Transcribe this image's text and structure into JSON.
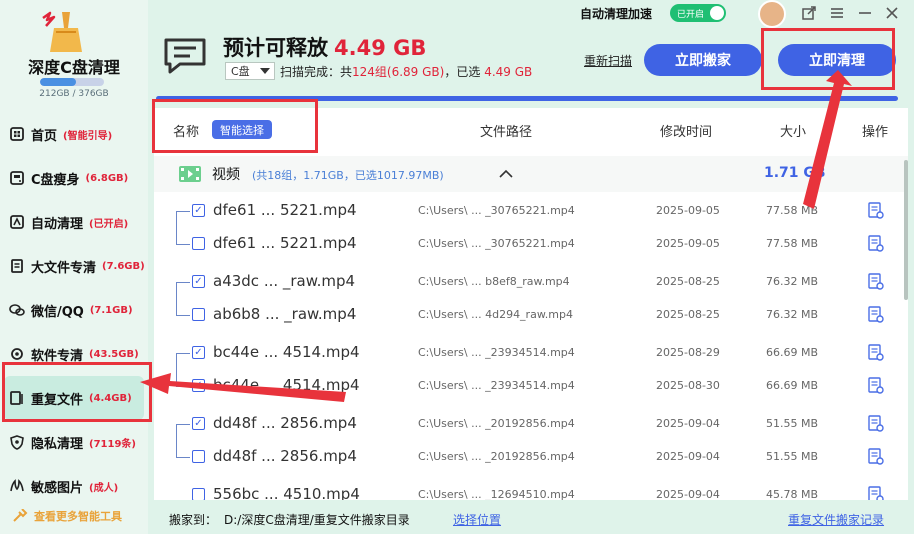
{
  "app": {
    "title": "深度C盘清理",
    "disk_usage": "212GB / 376GB",
    "disk_fraction": 0.56
  },
  "titlebar": {
    "auto_clean_label": "自动清理加速",
    "toggle_label": "已开启",
    "toggle_on": true
  },
  "header": {
    "headline": "预计可释放",
    "headline_size": "4.49 GB",
    "drive": "C盘",
    "scan_prefix": "扫描完成：共",
    "scan_groups": "124组(6.89 GB)",
    "scan_mid": "，已选",
    "scan_selected": "4.49 GB",
    "rescan": "重新扫描",
    "move_button": "立即搬家",
    "clean_button": "立即清理",
    "progress": 1.0
  },
  "sidebar": {
    "items": [
      {
        "label": "首页",
        "badge": "(智能引导)",
        "icon": "home-icon"
      },
      {
        "label": "C盘瘦身",
        "badge": "(6.8GB)",
        "icon": "disk-icon"
      },
      {
        "label": "自动清理",
        "badge": "(已开启)",
        "icon": "auto-clean-icon"
      },
      {
        "label": "大文件专清",
        "badge": "(7.6GB)",
        "icon": "large-file-icon"
      },
      {
        "label": "微信/QQ",
        "badge": "(7.1GB)",
        "icon": "chat-icon"
      },
      {
        "label": "软件专清",
        "badge": "(43.5GB)",
        "icon": "software-icon"
      },
      {
        "label": "重复文件",
        "badge": "(4.4GB)",
        "icon": "duplicate-icon"
      },
      {
        "label": "隐私清理",
        "badge": "(7119条)",
        "icon": "privacy-icon"
      },
      {
        "label": "敏感图片",
        "badge": "(成人)",
        "icon": "image-icon"
      }
    ],
    "more_tools": "查看更多智能工具"
  },
  "table": {
    "col_name": "名称",
    "smart_select": "智能选择",
    "col_path": "文件路径",
    "col_modified": "修改时间",
    "col_size": "大小",
    "col_action": "操作",
    "group": {
      "name": "视频",
      "meta": "(共18组，1.71GB，已选1017.97MB)",
      "size": "1.71 GB"
    },
    "rows": [
      {
        "name": "dfe61 ... 5221.mp4",
        "path": "C:\\Users\\ ... _30765221.mp4",
        "date": "2025-09-05",
        "size": "77.58 MB",
        "checked": true
      },
      {
        "name": "dfe61 ... 5221.mp4",
        "path": "C:\\Users\\ ... _30765221.mp4",
        "date": "2025-09-05",
        "size": "77.58 MB",
        "checked": false
      },
      {
        "name": "a43dc ... _raw.mp4",
        "path": "C:\\Users\\ ... b8ef8_raw.mp4",
        "date": "2025-08-25",
        "size": "76.32 MB",
        "checked": true
      },
      {
        "name": "ab6b8 ... _raw.mp4",
        "path": "C:\\Users\\ ... 4d294_raw.mp4",
        "date": "2025-08-25",
        "size": "76.32 MB",
        "checked": false
      },
      {
        "name": "bc44e ... 4514.mp4",
        "path": "C:\\Users\\ ... _23934514.mp4",
        "date": "2025-08-29",
        "size": "66.69 MB",
        "checked": true
      },
      {
        "name": "bc44e ... 4514.mp4",
        "path": "C:\\Users\\ ... _23934514.mp4",
        "date": "2025-08-30",
        "size": "66.69 MB",
        "checked": true
      },
      {
        "name": "dd48f ... 2856.mp4",
        "path": "C:\\Users\\ ... _20192856.mp4",
        "date": "2025-09-04",
        "size": "51.55 MB",
        "checked": true
      },
      {
        "name": "dd48f ... 2856.mp4",
        "path": "C:\\Users\\ ... _20192856.mp4",
        "date": "2025-09-04",
        "size": "51.55 MB",
        "checked": false
      },
      {
        "name": "556bc ... 4510.mp4",
        "path": "C:\\Users\\ ... _12694510.mp4",
        "date": "2025-09-04",
        "size": "45.78 MB",
        "checked": false
      }
    ]
  },
  "footer": {
    "move_to_label": "搬家到：",
    "move_path": "D:/深度C盘清理/重复文件搬家目录",
    "choose_location": "选择位置",
    "move_record": "重复文件搬家记录"
  },
  "colors": {
    "accent": "#3f63e4",
    "danger": "#e0243a",
    "toggle": "#1fbf73",
    "highlight": "#e8333c"
  }
}
